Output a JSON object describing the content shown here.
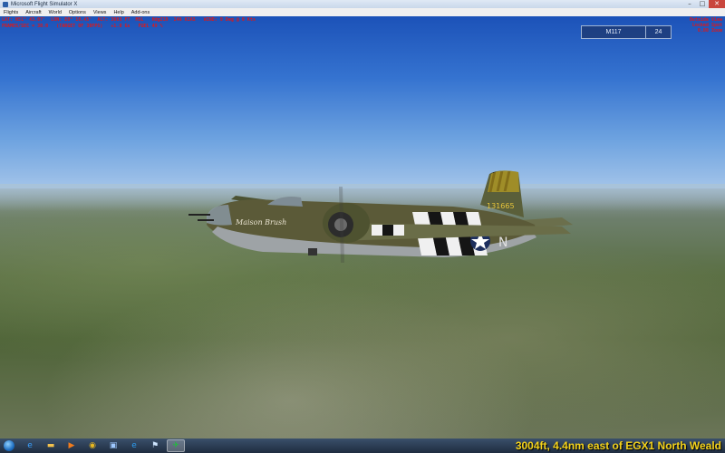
{
  "window": {
    "title": "Microsoft Flight Simulator X",
    "controls": {
      "minimize": "–",
      "maximize": "□",
      "close": "✕"
    }
  },
  "menu": {
    "items": [
      "Flights",
      "Aircraft",
      "World",
      "Options",
      "Views",
      "Help",
      "Add-ons"
    ]
  },
  "hud": {
    "line1": "LAT: N51° 43.07'  LON: E0° 10.45'  ALT: 3003 FT  MSL   Hdg219  246 KIAS   WIND: 0 Deg @ 0 Kts",
    "line2": "FRAMES/SEC = 30.0   (TARGET OF 30FPS)   +1.0 Gs   FUEL 49 %",
    "view_mode": "Outside View",
    "view_name": "Locked Spot",
    "zoom": "0.80 Zoom"
  },
  "atc": {
    "tag": "M117",
    "value": "24"
  },
  "aircraft": {
    "serial": "131665",
    "nose_art": "Maison Brush",
    "code": "N"
  },
  "taskbar": {
    "icons": [
      {
        "name": "ie-icon",
        "glyph": "e",
        "color": "#3aa0ff",
        "active": false
      },
      {
        "name": "folder-icon",
        "glyph": "▬",
        "color": "#f2c14e",
        "active": false
      },
      {
        "name": "media-player-icon",
        "glyph": "▶",
        "color": "#f07b1d",
        "active": false
      },
      {
        "name": "chrome-icon",
        "glyph": "◉",
        "color": "#e8b820",
        "active": false
      },
      {
        "name": "photos-icon",
        "glyph": "▣",
        "color": "#9ec8ff",
        "active": false
      },
      {
        "name": "edge-icon",
        "glyph": "e",
        "color": "#2d9cf0",
        "active": false
      },
      {
        "name": "network-icon",
        "glyph": "⚑",
        "color": "#cfe6ff",
        "active": false
      },
      {
        "name": "flight-sim-icon",
        "glyph": "✈",
        "color": "#1fbf3a",
        "active": true
      }
    ],
    "status_text": "3004ft, 4.4nm east of EGX1 North Weald"
  }
}
